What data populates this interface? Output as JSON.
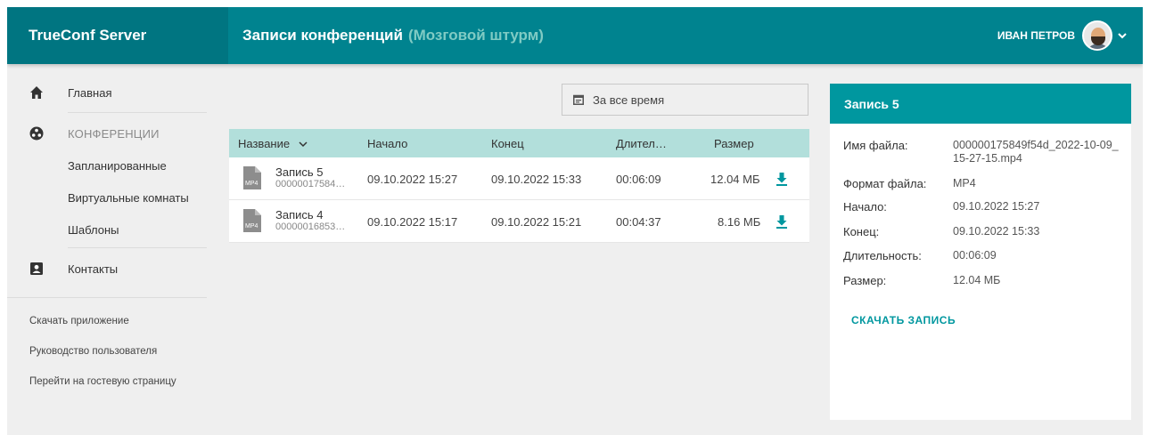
{
  "header": {
    "brand": "TrueConf Server",
    "title": "Записи конференций",
    "subtitle": "(Мозговой штурм)",
    "user_name": "ИВАН ПЕТРОВ"
  },
  "sidebar": {
    "home": "Главная",
    "conferences": "КОНФЕРЕНЦИИ",
    "scheduled": "Запланированные",
    "virtual_rooms": "Виртуальные комнаты",
    "templates": "Шаблоны",
    "contacts": "Контакты",
    "footer_links": [
      "Скачать приложение",
      "Руководство пользователя",
      "Перейти на гостевую страницу"
    ]
  },
  "filter": {
    "label": "За все время"
  },
  "table": {
    "columns": [
      "Название",
      "Начало",
      "Конец",
      "Длител…",
      "Размер"
    ],
    "rows": [
      {
        "name": "Запись 5",
        "file": "00000017584…",
        "start": "09.10.2022 15:27",
        "end": "09.10.2022 15:33",
        "duration": "00:06:09",
        "size": "12.04 МБ"
      },
      {
        "name": "Запись 4",
        "file": "00000016853…",
        "start": "09.10.2022 15:17",
        "end": "09.10.2022 15:21",
        "duration": "00:04:37",
        "size": "8.16 МБ"
      }
    ],
    "file_type_badge": "MP4"
  },
  "details": {
    "title": "Запись 5",
    "fields": [
      {
        "key": "Имя файла:",
        "value": "000000175849f54d_2022-10-09_15-27-15.mp4"
      },
      {
        "key": "Формат файла:",
        "value": "MP4"
      },
      {
        "key": "Начало:",
        "value": "09.10.2022 15:27"
      },
      {
        "key": "Конец:",
        "value": "09.10.2022 15:33"
      },
      {
        "key": "Длительность:",
        "value": "00:06:09"
      },
      {
        "key": "Размер:",
        "value": "12.04 МБ"
      }
    ],
    "download_label": "СКАЧАТЬ ЗАПИСЬ"
  },
  "colors": {
    "header": "#00838f",
    "accent": "#00979f",
    "table_header": "#b2dfdb"
  },
  "icons": [
    "home-icon",
    "conference-icon",
    "contacts-icon",
    "calendar-icon",
    "download-icon",
    "file-mp4-icon",
    "chevron-down-icon",
    "sort-icon"
  ]
}
